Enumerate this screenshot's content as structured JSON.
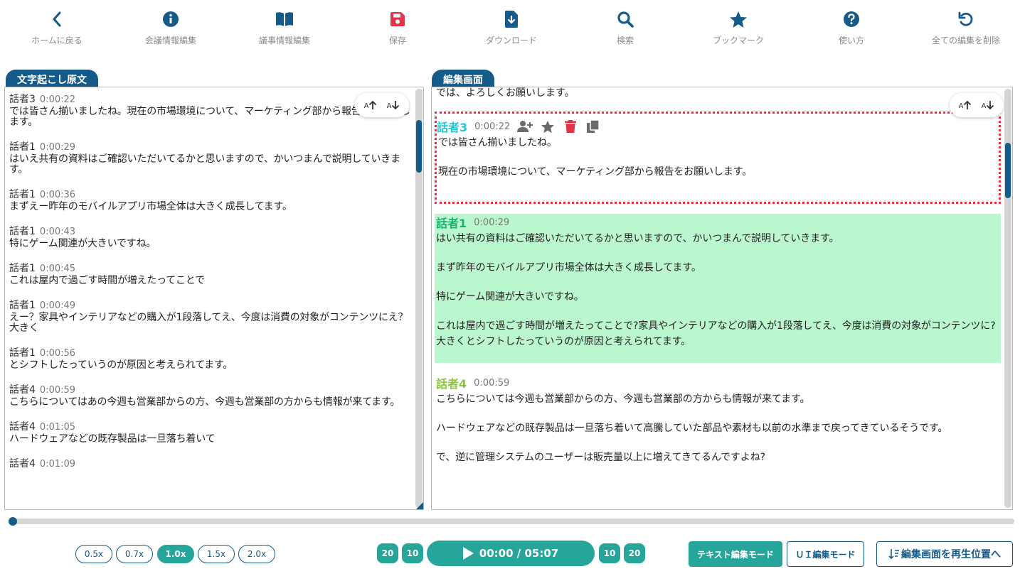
{
  "toolbar": {
    "items": [
      {
        "label": "ホームに戻る",
        "icon": "chevron-left-icon"
      },
      {
        "label": "会議情報編集",
        "icon": "info-icon"
      },
      {
        "label": "議事情報編集",
        "icon": "book-icon"
      },
      {
        "label": "保存",
        "icon": "save-icon"
      },
      {
        "label": "ダウンロード",
        "icon": "download-icon"
      },
      {
        "label": "検索",
        "icon": "search-icon"
      },
      {
        "label": "ブックマーク",
        "icon": "star-icon"
      },
      {
        "label": "使い方",
        "icon": "help-icon"
      },
      {
        "label": "全ての編集を削除",
        "icon": "undo-icon"
      }
    ]
  },
  "colors": {
    "primary": "#155b8a",
    "accent": "#26a69a",
    "save_red": "#e0344a",
    "speaker3": "#1fc8d8",
    "speaker1": "#17b36a",
    "speaker4": "#8cc63f",
    "selected_border": "#e0344a",
    "highlight_bg": "#baf7ce"
  },
  "left_panel": {
    "title": "文字起こし原文",
    "entries": [
      {
        "speaker": "話者3",
        "time": "0:00:22",
        "text": "では皆さん揃いましたね。現在の市場環境について、マーケティング部から報告をお願いします。"
      },
      {
        "speaker": "話者1",
        "time": "0:00:29",
        "text": "はいえ共有の資料はご確認いただいてるかと思いますので、かいつまんで説明していきます。"
      },
      {
        "speaker": "話者1",
        "time": "0:00:36",
        "text": "まずえー昨年のモバイルアプリ市場全体は大きく成長してます。"
      },
      {
        "speaker": "話者1",
        "time": "0:00:43",
        "text": "特にゲーム関連が大きいですね。"
      },
      {
        "speaker": "話者1",
        "time": "0:00:45",
        "text": "これは屋内で過ごす時間が増えたってことで"
      },
      {
        "speaker": "話者1",
        "time": "0:00:49",
        "text": "えー？家具やインテリアなどの購入が1段落してえ、今度は消費の対象がコンテンツにえ？大きく"
      },
      {
        "speaker": "話者1",
        "time": "0:00:56",
        "text": "とシフトしたっていうのが原因と考えられてます。"
      },
      {
        "speaker": "話者4",
        "time": "0:00:59",
        "text": "こちらについてはあの今週も営業部からの方、今週も営業部の方からも情報が来てます。"
      },
      {
        "speaker": "話者4",
        "time": "0:01:05",
        "text": "ハードウェアなどの既存製品は一旦落ち着いて"
      },
      {
        "speaker": "話者4",
        "time": "0:01:09",
        "text": ""
      }
    ]
  },
  "right_panel": {
    "title": "編集画面",
    "top_line": "では、よろしくお願いします。",
    "blocks": [
      {
        "speaker": "話者3",
        "time": "0:00:22",
        "paragraphs": [
          "では皆さん揃いましたね。",
          "現在の市場環境について、マーケティング部から報告をお願いします。"
        ]
      },
      {
        "speaker": "話者1",
        "time": "0:00:29",
        "paragraphs": [
          "はい共有の資料はご確認いただいてるかと思いますので、かいつまんで説明していきます。",
          "まず昨年のモバイルアプリ市場全体は大きく成長してます。",
          "特にゲーム関連が大きいですね。",
          "これは屋内で過ごす時間が増えたってことで?家具やインテリアなどの購入が1段落してえ、今度は消費の対象がコンテンツに?大きくとシフトしたっていうのが原因と考えられてます。"
        ]
      },
      {
        "speaker": "話者4",
        "time": "0:00:59",
        "paragraphs": [
          "こちらについては今週も営業部からの方、今週も営業部の方からも情報が来てます。",
          "ハードウェアなどの既存製品は一旦落ち着いて高騰していた部品や素材も以前の水準まで戻ってきているそうです。",
          "で、逆に管理システムのユーザーは販売量以上に増えてきてるんですよね?"
        ]
      }
    ]
  },
  "font_size": {
    "up": "A",
    "down": "A"
  },
  "player": {
    "progress_fraction": 0.0,
    "speeds": [
      "0.5x",
      "0.7x",
      "1.0x",
      "1.5x",
      "2.0x"
    ],
    "active_speed": "1.0x",
    "skip_back": [
      "20",
      "10"
    ],
    "skip_forward": [
      "10",
      "20"
    ],
    "time_display": "00:00 / 05:07"
  },
  "modes": {
    "text_mode": "テキスト編集モード",
    "ui_mode": "ＵＩ編集モード",
    "jump_label": "編集画面を再生位置へ"
  }
}
